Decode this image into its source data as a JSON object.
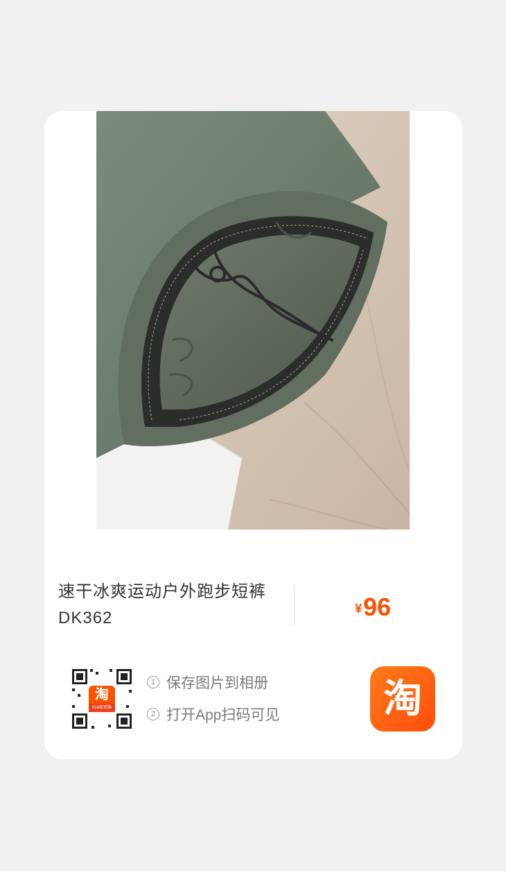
{
  "product": {
    "title_line1": "速干冰爽运动户外跑步短裤",
    "title_line2": "DK362",
    "currency": "¥",
    "price": "96"
  },
  "qr": {
    "badge_text": "淘",
    "badge_sub": "618狂欢购"
  },
  "steps": [
    {
      "num": "1",
      "label": "保存图片到相册"
    },
    {
      "num": "2",
      "label": "打开App扫码可见"
    }
  ],
  "brand": {
    "logo_text": "淘",
    "accent_color": "#ff5000"
  },
  "photo": {
    "subject": "green shorts waistband with drawstring"
  }
}
